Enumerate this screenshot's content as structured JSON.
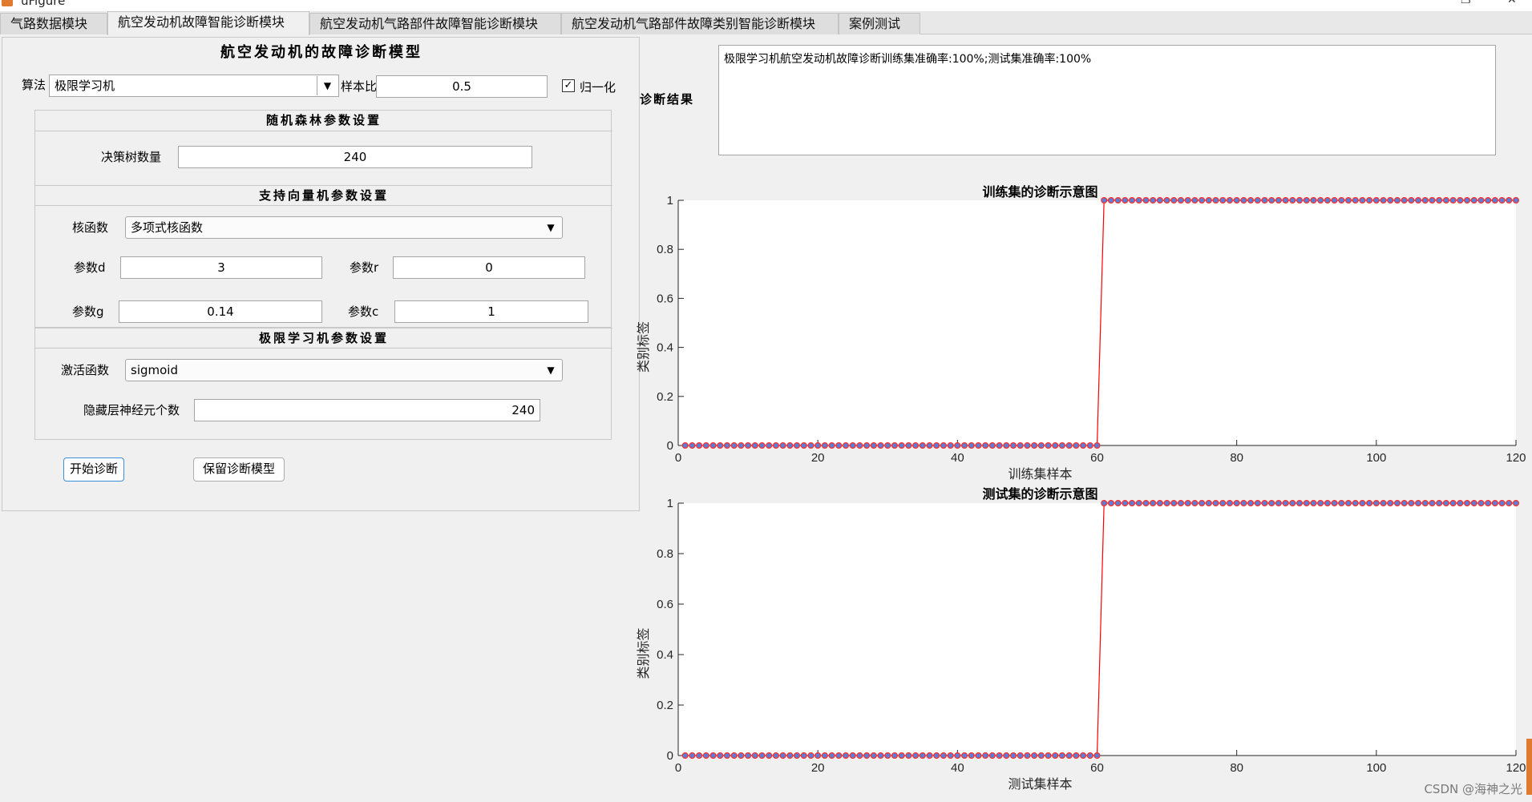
{
  "window": {
    "title": "uFigure"
  },
  "tabs": [
    {
      "label": "气路数据模块"
    },
    {
      "label": "航空发动机故障智能诊断模块"
    },
    {
      "label": "航空发动机气路部件故障智能诊断模块"
    },
    {
      "label": "航空发动机气路部件故障类别智能诊断模块"
    },
    {
      "label": "案例测试"
    }
  ],
  "model": {
    "title": "航空发动机的故障诊断模型",
    "algorithm_label": "算法",
    "algorithm_value": "极限学习机",
    "sample_ratio_label": "样本比",
    "sample_ratio_value": "0.5",
    "normalize_label": "归一化",
    "normalize_checked": true
  },
  "random_forest": {
    "title": "随机森林参数设置",
    "trees_label": "决策树数量",
    "trees_value": "240"
  },
  "svm": {
    "title": "支持向量机参数设置",
    "kernel_label": "核函数",
    "kernel_value": "多项式核函数",
    "d_label": "参数d",
    "d_value": "3",
    "r_label": "参数r",
    "r_value": "0",
    "g_label": "参数g",
    "g_value": "0.14",
    "c_label": "参数c",
    "c_value": "1"
  },
  "elm": {
    "title": "极限学习机参数设置",
    "activation_label": "激活函数",
    "activation_value": "sigmoid",
    "hidden_label": "隐藏层神经元个数",
    "hidden_value": "240"
  },
  "buttons": {
    "start": "开始诊断",
    "save": "保留诊断模型"
  },
  "result": {
    "label": "诊断结果",
    "text": "极限学习机航空发动机故障诊断训练集准确率:100%;测试集准确率:100%"
  },
  "watermark": "CSDN @海神之光",
  "colors": {
    "line": "#ff0000",
    "marker_edge": "#ff2a2a",
    "marker_face": "#5b7fd8"
  },
  "chart_data": [
    {
      "type": "scatter",
      "title": "训练集的诊断示意图",
      "xlabel": "训练集样本",
      "ylabel": "类别标签",
      "xlim": [
        0,
        120
      ],
      "ylim": [
        0,
        1
      ],
      "xticks": [
        "0",
        "20",
        "40",
        "60",
        "80",
        "100",
        "120"
      ],
      "yticks": [
        "0",
        "0.2",
        "0.4",
        "0.6",
        "0.8",
        "1"
      ],
      "grid": false,
      "series": [
        {
          "n": 120,
          "step_after": 60,
          "low": 0,
          "high": 1
        }
      ]
    },
    {
      "type": "scatter",
      "title": "测试集的诊断示意图",
      "xlabel": "测试集样本",
      "ylabel": "类别标签",
      "xlim": [
        0,
        120
      ],
      "ylim": [
        0,
        1
      ],
      "xticks": [
        "0",
        "20",
        "40",
        "60",
        "80",
        "100",
        "120"
      ],
      "yticks": [
        "0",
        "0.2",
        "0.4",
        "0.6",
        "0.8",
        "1"
      ],
      "grid": false,
      "series": [
        {
          "n": 120,
          "step_after": 60,
          "low": 0,
          "high": 1
        }
      ]
    }
  ]
}
